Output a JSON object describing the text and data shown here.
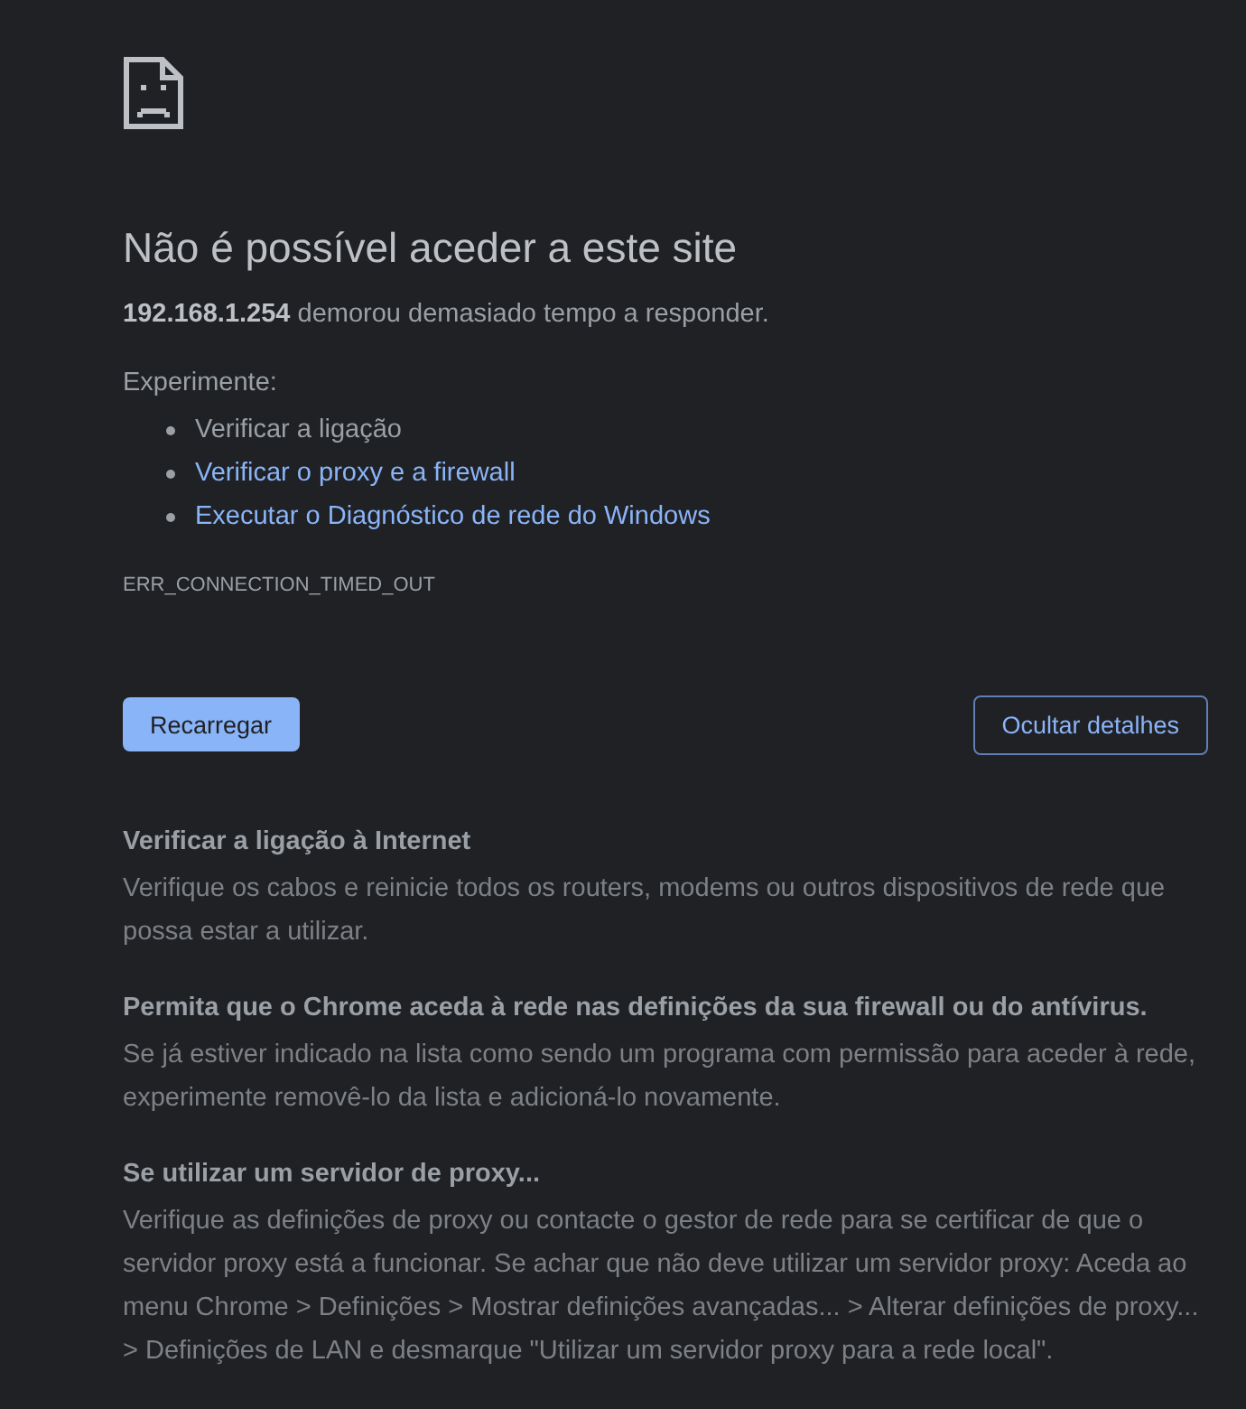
{
  "heading": "Não é possível aceder a este site",
  "summary": "**192.168.1.254** demorou demasiado tempo a responder.",
  "suggestions_intro": "Experimente:",
  "suggestions": [
    {
      "text": "Verificar a ligação",
      "kind": "text"
    },
    {
      "text": "Verificar o proxy e a firewall",
      "kind": "link"
    },
    {
      "text": "Executar o Diagnóstico de rede do Windows",
      "kind": "link"
    }
  ],
  "error_code": "ERR_CONNECTION_TIMED_OUT",
  "buttons": [
    {
      "label": "Recarregar",
      "kind": "primary"
    },
    {
      "label": "Ocultar detalhes",
      "kind": "secondary"
    }
  ],
  "details": [
    {
      "title": "Verificar a ligação à Internet",
      "body": "Verifique os cabos e reinicie todos os routers, modems ou outros dispositivos de rede que possa estar a utilizar."
    },
    {
      "title": "Permita que o Chrome aceda à rede nas definições da sua firewall ou do antívirus.",
      "body": "Se já estiver indicado na lista como sendo um programa com permissão para aceder à rede, experimente removê-lo da lista e adicioná-lo novamente."
    },
    {
      "title": "Se utilizar um servidor de proxy...",
      "body": "Verifique as definições de proxy ou contacte o gestor de rede para se certificar de que o servidor proxy está a funcionar. Se achar que não deve utilizar um servidor proxy: Aceda ao menu Chrome > Definições > Mostrar definições avançadas... > Alterar definições de proxy... > Definições de LAN e desmarque \"Utilizar um servidor proxy para a rede local\"."
    }
  ]
}
